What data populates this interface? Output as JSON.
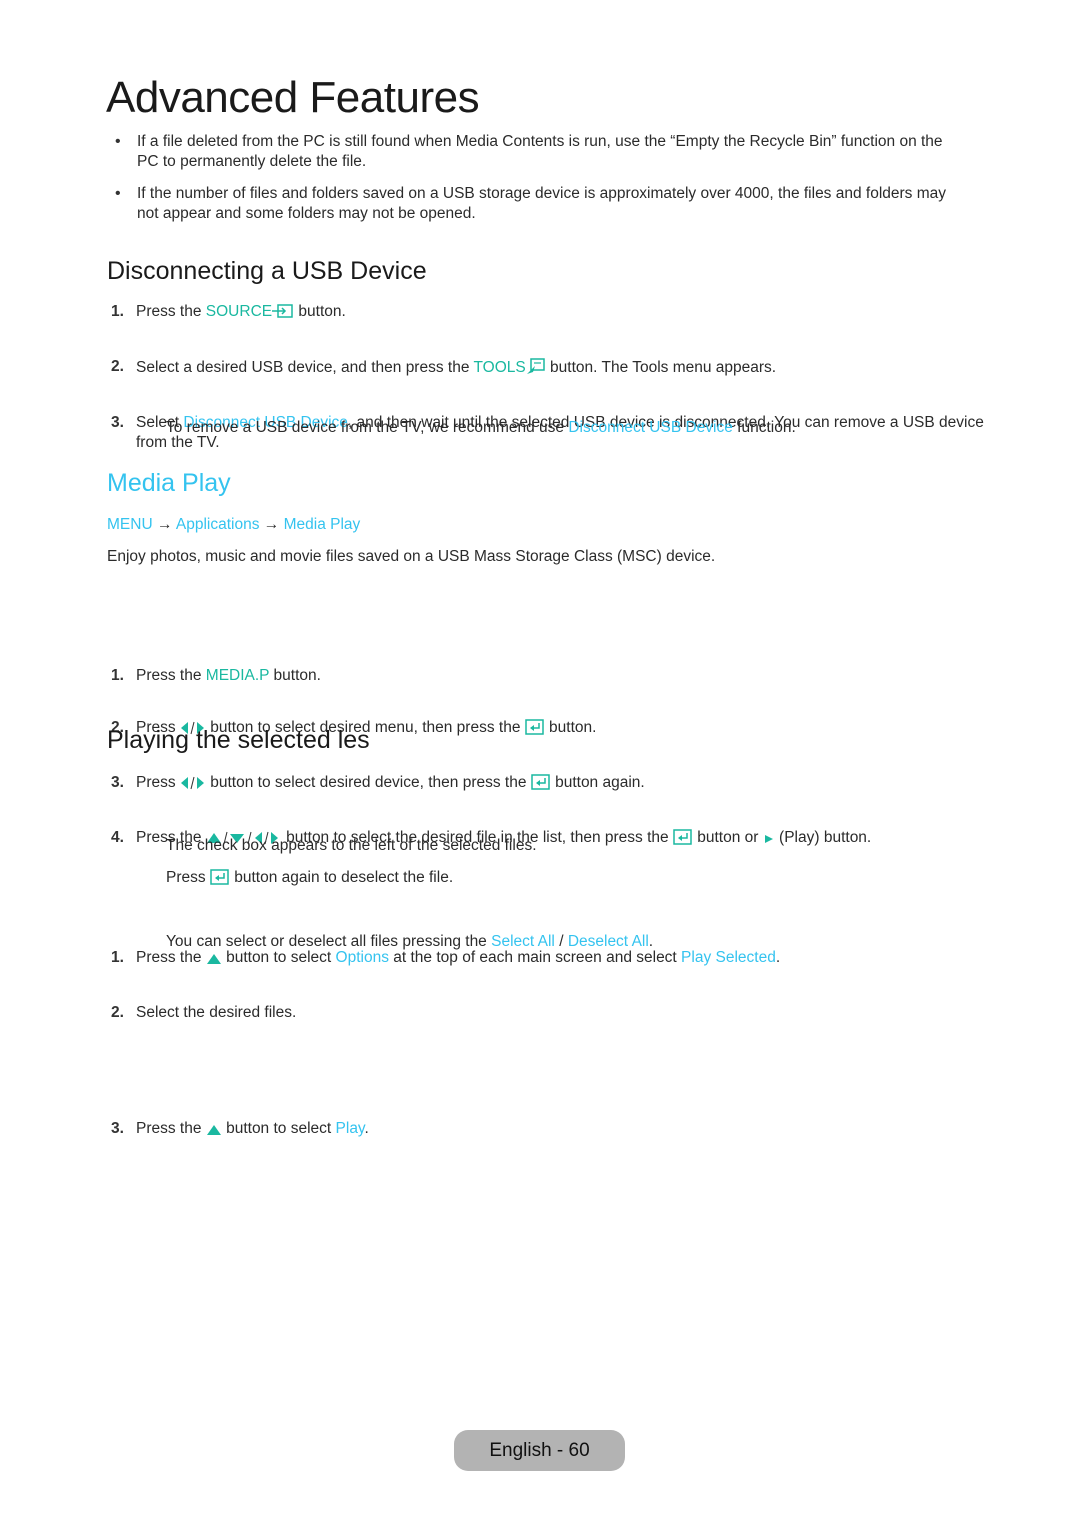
{
  "page_title": "Advanced Features",
  "bullets": [
    {
      "text": "If a file deleted from the PC is still found when Media Contents is run, use the “Empty the Recycle Bin” function on the PC to permanently delete the file."
    },
    {
      "text": "If the number of files and folders saved on a USB storage device is approximately over 4000, the files and folders may not appear and some folders may not be opened."
    }
  ],
  "disconnect": {
    "heading": "Disconnecting a USB Device",
    "steps": [
      {
        "num": "1.",
        "a": "Press the ",
        "key": "SOURCE",
        "icon": "source-icon",
        "b": " button."
      },
      {
        "num": "2.",
        "a": "Select a desired USB device, and then press the ",
        "key": "TOOLS",
        "icon": "tools-icon",
        "b": " button. The Tools menu appears."
      },
      {
        "num": "3.",
        "a": "Select ",
        "link": "Disconnect USB Device",
        "b": ", and then wait until the selected USB device is disconnected. You can remove a USB device from the TV."
      }
    ],
    "note": {
      "a": "To remove a USB device from the TV, we recommend use ",
      "link": "Disconnect USB Device",
      "b": " function."
    }
  },
  "media_play": {
    "heading": "Media Play",
    "menu_path": [
      "MENU",
      "Applications",
      "Media Play"
    ],
    "arrow": "→",
    "intro": "Enjoy photos, music and movie files saved on a USB Mass Storage Class (MSC) device.",
    "steps": [
      {
        "num": "1.",
        "a": "Press the ",
        "key": "MEDIA.P",
        "b": " button."
      },
      {
        "num": "2.",
        "a": "Press ",
        "b": " button to select desired menu, then press the ",
        "c": " button."
      },
      {
        "num": "3.",
        "a": "Press ",
        "b": " button to select desired device, then press the ",
        "c": " button again."
      },
      {
        "num": "4.",
        "a": "Press the ",
        "b": " button to select the desired file in the list, then press the ",
        "c": " button or ",
        "d": " (Play) button."
      }
    ]
  },
  "playing": {
    "heading": "Playing the selected  les",
    "steps": [
      {
        "num": "1.",
        "a": "Press the ",
        "b": " button to select ",
        "link1": "Options",
        "c": " at the top of each main screen and select ",
        "link2": "Play Selected",
        "d": "."
      },
      {
        "num": "2.",
        "a": "Select the desired files."
      },
      {
        "num": "3.",
        "a": "Press the ",
        "b": " button to select ",
        "link1": "Play",
        "c": "."
      }
    ],
    "note1": "The check box appears to the left of the selected files.",
    "note2": {
      "a": "Press ",
      "b": " button again to deselect the file."
    },
    "note3": {
      "a": "You can select or deselect all files pressing the ",
      "link1": "Select All",
      "sep": " / ",
      "link2": "Deselect All",
      "b": "."
    }
  },
  "footer": {
    "label": "English - 60"
  },
  "colors": {
    "teal": "#1ab8a0",
    "cyan": "#34c3ef",
    "footer_bg": "#b3b3b3"
  }
}
